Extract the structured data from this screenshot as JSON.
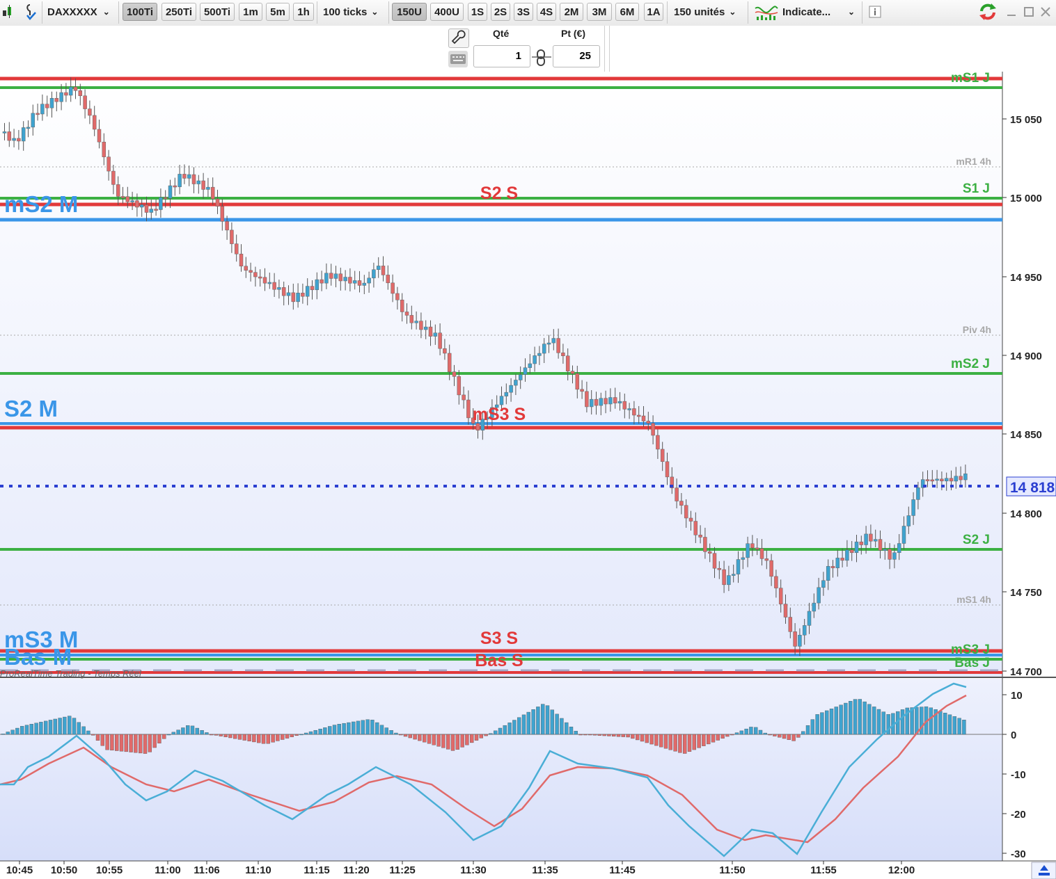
{
  "toolbar": {
    "instrument": "DAXXXXX",
    "tick_buttons": [
      "100Ti",
      "250Ti",
      "500Ti",
      "1m",
      "5m",
      "1h"
    ],
    "ticks_dropdown": "100 ticks",
    "unit_buttons": [
      "150U",
      "400U",
      "1S",
      "2S",
      "3S",
      "4S",
      "2M",
      "3M",
      "6M",
      "1A"
    ],
    "units_dropdown": "150 unités",
    "indicators_label": "Indicate...",
    "active_tick": "100Ti",
    "active_unit": "150U"
  },
  "order": {
    "qty_label": "Qté",
    "pt_label": "Pt (€)",
    "qty_value": "1",
    "pt_value": "25"
  },
  "chart": {
    "watermark": "ProRealTime Trading - Temps Réel",
    "current_price": "14 818",
    "price_ticks": [
      "15 050",
      "15 000",
      "14 950",
      "14 900",
      "14 850",
      "14 800",
      "14 750",
      "14 700"
    ],
    "osc_ticks": [
      "10",
      "0",
      "-10",
      "-20",
      "-30"
    ],
    "time_ticks": [
      "10:45",
      "10:50",
      "10:55",
      "11:00",
      "11:06",
      "11:10",
      "11:15",
      "11:20",
      "11:25",
      "11:30",
      "11:35",
      "11:45",
      "11:50",
      "11:55",
      "12:00"
    ],
    "labels": {
      "ms1j": "mS1 J",
      "mr14h": "mR1 4h",
      "s2s": "S2 S",
      "s1j": "S1 J",
      "ms2m": "mS2 M",
      "piv4h": "Piv 4h",
      "ms2j": "mS2 J",
      "s2m": "S2 M",
      "ms3s": "mS3 S",
      "s2j": "S2 J",
      "ms14h": "mS1 4h",
      "s3s": "S3 S",
      "ms3m": "mS3 M",
      "ms3j": "mS3 J",
      "basm": "Bas M",
      "bass": "Bas S",
      "basj": "Bas J"
    }
  },
  "colors": {
    "up": "#3fa3cf",
    "down": "#e06a6a",
    "red_line": "#e2393a",
    "green_line": "#3cb043",
    "blue_line": "#3a96e8",
    "price_line": "#2b3fd1"
  }
}
